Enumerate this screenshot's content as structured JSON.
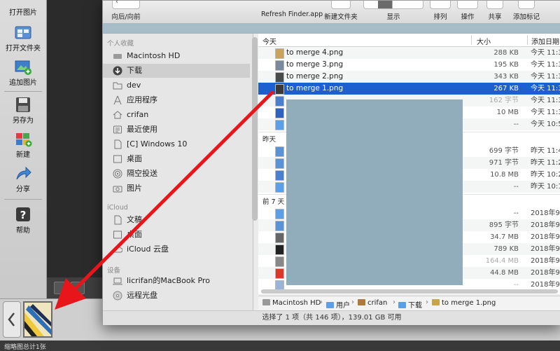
{
  "app_toolbar": {
    "buttons": [
      {
        "label": "打开图片",
        "icon": "open-image-icon"
      },
      {
        "label": "打开文件夹",
        "icon": "open-folder-icon"
      },
      {
        "label": "追加图片",
        "icon": "append-image-icon"
      },
      {
        "label": "另存为",
        "icon": "save-as-icon"
      },
      {
        "label": "新建",
        "icon": "new-icon"
      },
      {
        "label": "分享",
        "icon": "share-icon"
      },
      {
        "label": "帮助",
        "icon": "help-icon"
      }
    ]
  },
  "bottom": {
    "status": "缩略图总计1张"
  },
  "finder": {
    "toolbar": {
      "back_forward": "向后/向前",
      "refresh": "Refresh Finder.app",
      "new_folder": "新建文件夹",
      "view": "显示",
      "arrange": "排列",
      "action": "操作",
      "share": "共享",
      "tags": "添加标记"
    },
    "sidebar": {
      "favorites_header": "个人收藏",
      "favorites": [
        {
          "label": "Macintosh HD",
          "icon": "hard-drive-icon"
        },
        {
          "label": "下载",
          "icon": "downloads-icon",
          "selected": true
        },
        {
          "label": "dev",
          "icon": "folder-icon"
        },
        {
          "label": "应用程序",
          "icon": "applications-icon"
        },
        {
          "label": "crifan",
          "icon": "home-icon"
        },
        {
          "label": "最近使用",
          "icon": "recents-icon"
        },
        {
          "label": "[C] Windows 10",
          "icon": "document-icon"
        },
        {
          "label": "桌面",
          "icon": "desktop-icon"
        },
        {
          "label": "隔空投送",
          "icon": "airdrop-icon"
        },
        {
          "label": "图片",
          "icon": "camera-icon"
        }
      ],
      "icloud_header": "iCloud",
      "icloud": [
        {
          "label": "文稿",
          "icon": "document-icon"
        },
        {
          "label": "桌面",
          "icon": "desktop-icon"
        },
        {
          "label": "iCloud 云盘",
          "icon": "cloud-icon"
        }
      ],
      "devices_header": "设备",
      "devices": [
        {
          "label": "licrifan的MacBook Pro",
          "icon": "laptop-icon"
        },
        {
          "label": "远程光盘",
          "icon": "disc-icon"
        }
      ]
    },
    "columns": {
      "name": "今天",
      "size": "大小",
      "date": "添加日期"
    },
    "groups": [
      {
        "header": "",
        "rows": [
          {
            "name": "to merge 4.png",
            "size": "288 KB",
            "date": "今天 11:3"
          },
          {
            "name": "to merge 3.png",
            "size": "195 KB",
            "date": "今天 11:3"
          },
          {
            "name": "to merge 2.png",
            "size": "343 KB",
            "date": "今天 11:3"
          },
          {
            "name": "to merge 1.png",
            "size": "267 KB",
            "date": "今天 11:3",
            "selected": true
          },
          {
            "name": "",
            "size": "162 字节",
            "date": "今天 11:3",
            "dim": true
          },
          {
            "name": "",
            "size": "10 MB",
            "date": "今天 11:3"
          },
          {
            "name": "",
            "size": "--",
            "date": "今天 10:5"
          }
        ]
      },
      {
        "header": "昨天",
        "rows": [
          {
            "name": "",
            "size": "699 字节",
            "date": "昨天 11:4"
          },
          {
            "name": "",
            "size": "971 字节",
            "date": "昨天 11:2"
          },
          {
            "name": "",
            "size": "10.8 MB",
            "date": "昨天 10:2"
          },
          {
            "name": "",
            "size": "--",
            "date": "昨天 10:1"
          }
        ]
      },
      {
        "header": "前 7 天",
        "rows": [
          {
            "name": "",
            "size": "--",
            "date": "2018年9"
          },
          {
            "name": "",
            "size": "895 字节",
            "date": "2018年9"
          },
          {
            "name": "",
            "size": "34.7 MB",
            "date": "2018年9"
          },
          {
            "name": "",
            "size": "789 KB",
            "date": "2018年9"
          },
          {
            "name": "",
            "size": "164.4 MB",
            "date": "2018年9",
            "dim": true
          },
          {
            "name": "",
            "size": "44.8 MB",
            "date": "2018年9"
          },
          {
            "name": "",
            "size": "--",
            "date": "2018年9",
            "dim": true
          }
        ]
      }
    ],
    "path": [
      "Macintosh HD",
      "用户",
      "crifan",
      "下载",
      "to merge 1.png"
    ],
    "status": "选择了 1 项（共 146 项），139.01 GB 可用"
  },
  "colors": {
    "selection": "#1d5fd0",
    "arrow": "#e8161b",
    "redaction": "#91acbb"
  }
}
